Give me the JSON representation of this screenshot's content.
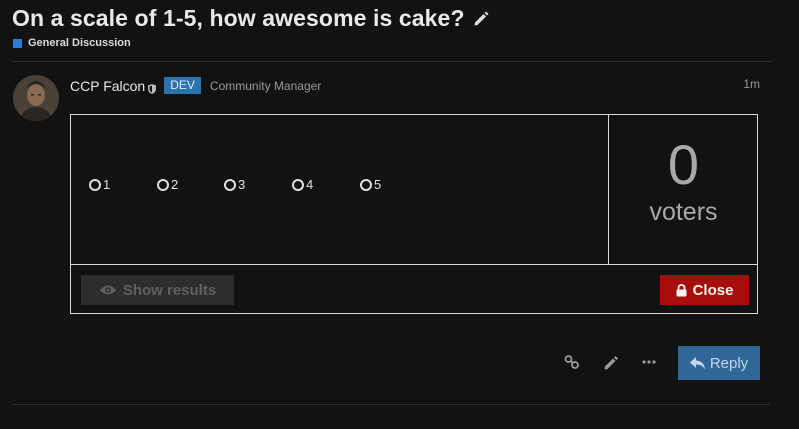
{
  "topic": {
    "title": "On a scale of 1-5, how awesome is cake?",
    "category": "General Discussion",
    "category_color": "#2a7fd1"
  },
  "post": {
    "username": "CCP Falcon",
    "badge": "DEV",
    "user_title": "Community Manager",
    "timestamp": "1m"
  },
  "poll": {
    "options": [
      "1",
      "2",
      "3",
      "4",
      "5"
    ],
    "voters_count": "0",
    "voters_label": "voters",
    "show_results_label": "Show results",
    "close_label": "Close"
  },
  "actions": {
    "reply_label": "Reply",
    "icons": [
      "link-icon",
      "pencil-icon",
      "ellipsis-icon"
    ]
  },
  "colors": {
    "background": "#121212",
    "dev_badge": "#2b72b1",
    "close_button": "#a80d0d",
    "reply_button": "#2f6898"
  }
}
